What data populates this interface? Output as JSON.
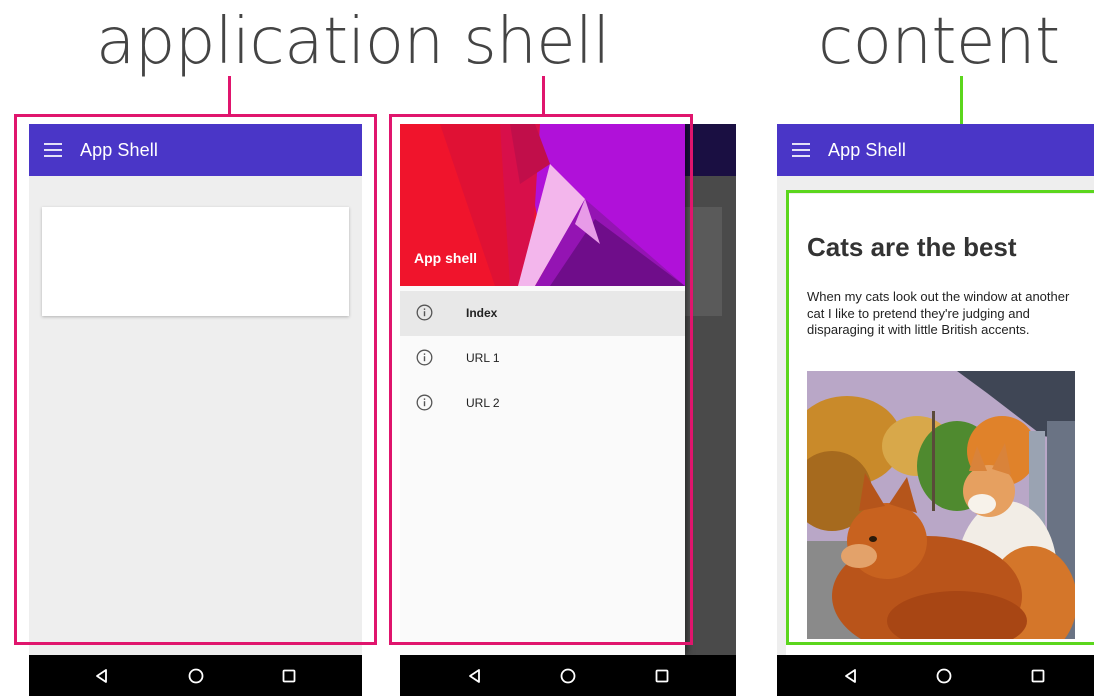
{
  "labels": {
    "application_shell": "application shell",
    "content": "content"
  },
  "screens": {
    "shell": {
      "appbar_title": "App Shell"
    },
    "drawer": {
      "header_title": "App shell",
      "items": [
        {
          "label": "Index",
          "icon": "info-icon",
          "active": true
        },
        {
          "label": "URL 1",
          "icon": "info-icon",
          "active": false
        },
        {
          "label": "URL 2",
          "icon": "info-icon",
          "active": false
        }
      ]
    },
    "content": {
      "appbar_title": "App Shell",
      "heading": "Cats are the best",
      "body": "When my cats look out the window at another cat I like to pretend they're judging and disparaging it with little British accents.",
      "image": "cats-at-window-photo"
    }
  },
  "navbar": {
    "icons": [
      "back-icon",
      "home-icon",
      "recents-icon"
    ]
  },
  "colors": {
    "appbar": "#4a36c7",
    "shell_outline": "#e0156d",
    "content_outline": "#5bd61d",
    "navbar": "#000000"
  }
}
